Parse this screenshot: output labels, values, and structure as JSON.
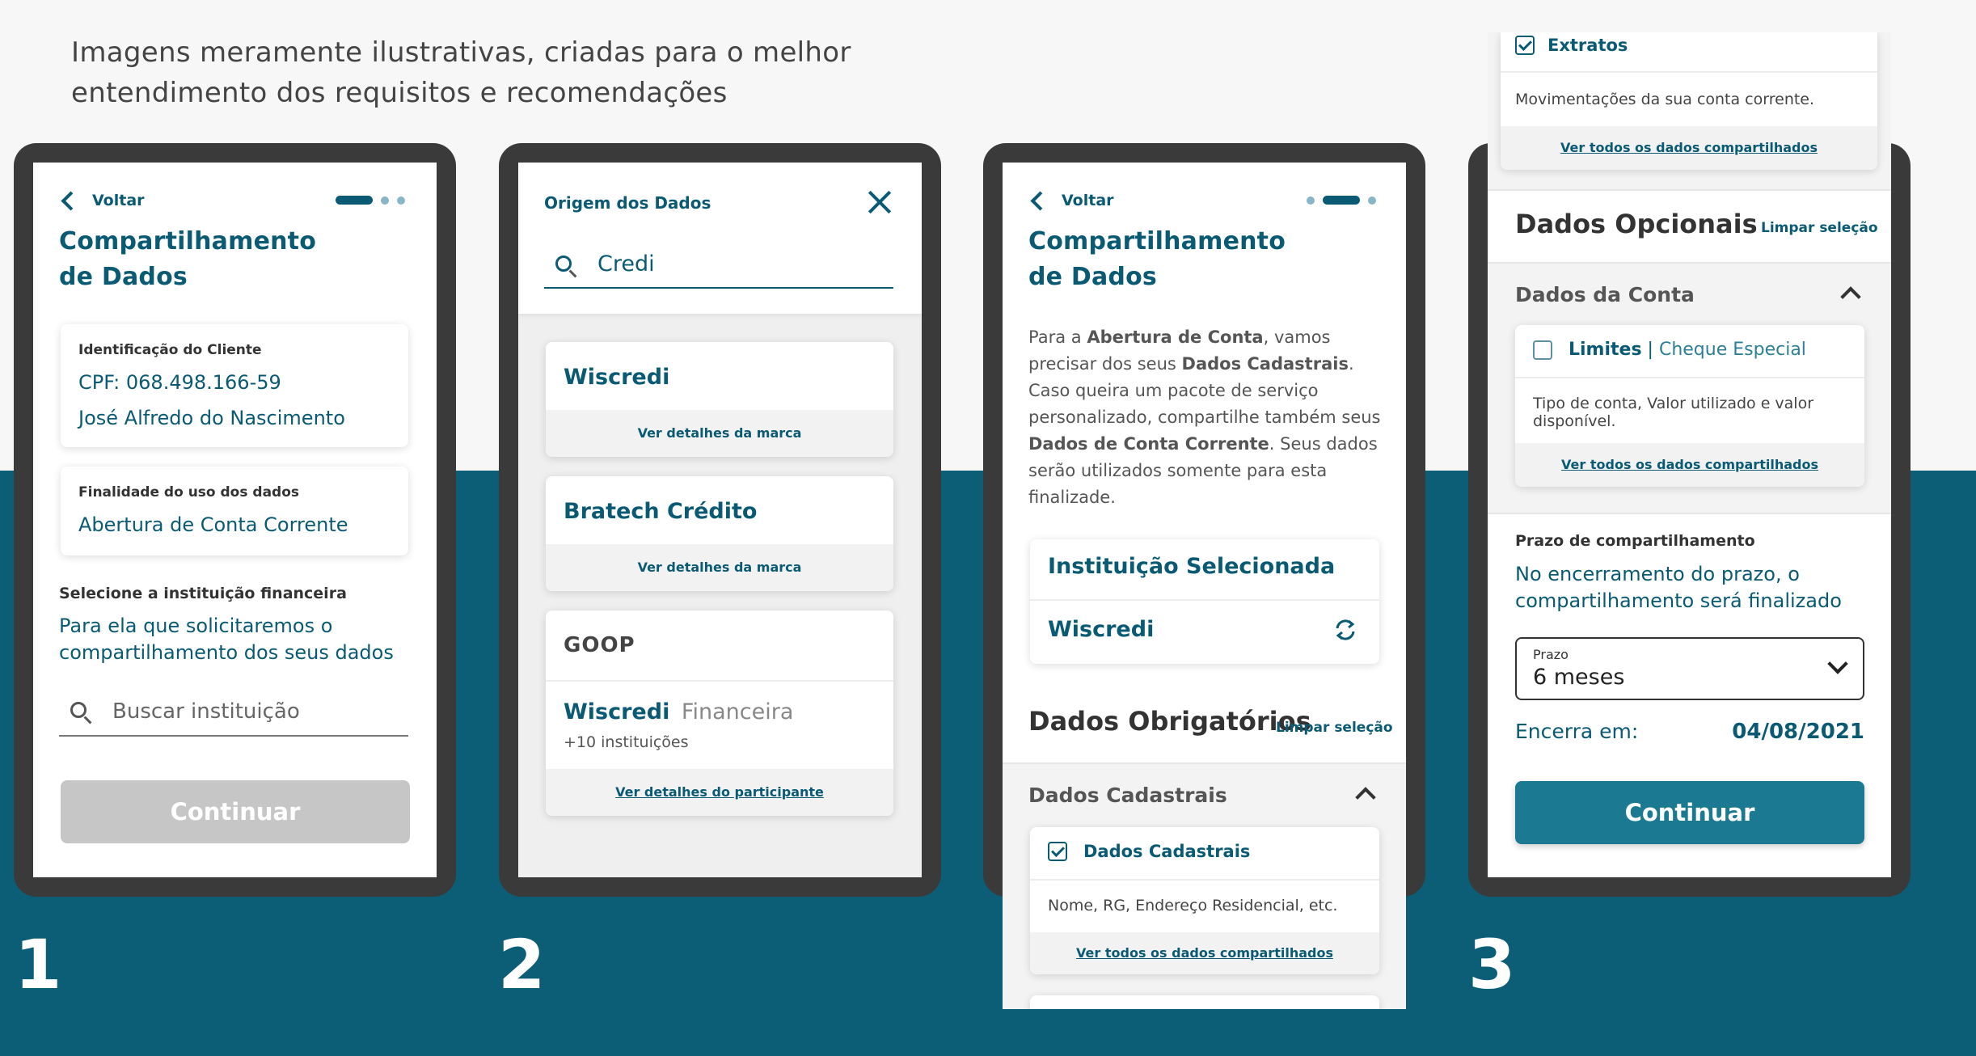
{
  "intro": {
    "line1": "Imagens meramente ilustrativas, criadas para o melhor",
    "line2": "entendimento dos requisitos e recomendações"
  },
  "steps": [
    "1",
    "2",
    "3"
  ],
  "screen1": {
    "back": "Voltar",
    "title1": "Compartilhamento",
    "title2": "de Dados",
    "client_label": "Identificação do Cliente",
    "cpf": "CPF: 068.498.166-59",
    "name": "José Alfredo do Nascimento",
    "purpose_label": "Finalidade do uso dos dados",
    "purpose": "Abertura de Conta Corrente",
    "select_label": "Selecione a instituição financeira",
    "select_desc1": "Para ela que solicitaremos o",
    "select_desc2": "compartilhamento dos seus dados",
    "search_placeholder": "Buscar instituição",
    "continue": "Continuar"
  },
  "screen2": {
    "title": "Origem dos Dados",
    "search_value": "Credi",
    "brand1": "Wiscredi",
    "brand1_link": "Ver detalhes da marca",
    "brand2": "Bratech Crédito",
    "brand2_link": "Ver detalhes da marca",
    "group": "GOOP",
    "participant_strong": "Wiscredi",
    "participant_light": "Financeira",
    "participant_more": "+10 instituições",
    "participant_link": "Ver detalhes do participante"
  },
  "screen3": {
    "back": "Voltar",
    "title1": "Compartilhamento",
    "title2": "de Dados",
    "para": {
      "p1": "Para a ",
      "b1": "Abertura de Conta",
      "p2": ", vamos precisar dos seus ",
      "b2": "Dados Cadastrais",
      "p3": ". Caso queira um pacote de serviço personalizado, compartilhe também seus ",
      "b3": "Dados de Conta Corrente",
      "p4": ". Seus dados serão utilizados somente para esta finalizade."
    },
    "inst_label": "Instituição Selecionada",
    "inst_value": "Wiscredi",
    "req_title": "Dados Obrigatórios",
    "req_clear": "Limpar seleção",
    "cad_head": "Dados Cadastrais",
    "cad_item": "Dados Cadastrais",
    "cad_desc": "Nome, RG, Endereço Residencial, etc.",
    "cad_link": "Ver todos os dados compartilhados"
  },
  "screen4": {
    "extratos": "Extratos",
    "extratos_desc": "Movimentações da sua conta corrente.",
    "extratos_link": "Ver todos os dados compartilhados",
    "opt_title": "Dados Opcionais",
    "opt_clear": "Limpar seleção",
    "conta_head": "Dados da Conta",
    "limites": "Limites",
    "sep": " | ",
    "cheque": "Cheque Especial",
    "limites_desc": "Tipo de conta, Valor utilizado e valor disponível.",
    "limites_link": "Ver todos os dados compartilhados",
    "prazo_label": "Prazo de compartilhamento",
    "prazo_desc1": "No encerramento do prazo, o",
    "prazo_desc2": "compartilhamento será finalizado",
    "select_label": "Prazo",
    "select_value": "6 meses",
    "ends_label": "Encerra em:",
    "ends_value": "04/08/2021",
    "continue": "Continuar"
  },
  "colors": {
    "teal_band": "#0c5e77",
    "primary_text": "#0a5a73",
    "button_active": "#1b7a91",
    "button_disabled": "#c6c6c6",
    "phone_frame": "#3a3a3a"
  }
}
